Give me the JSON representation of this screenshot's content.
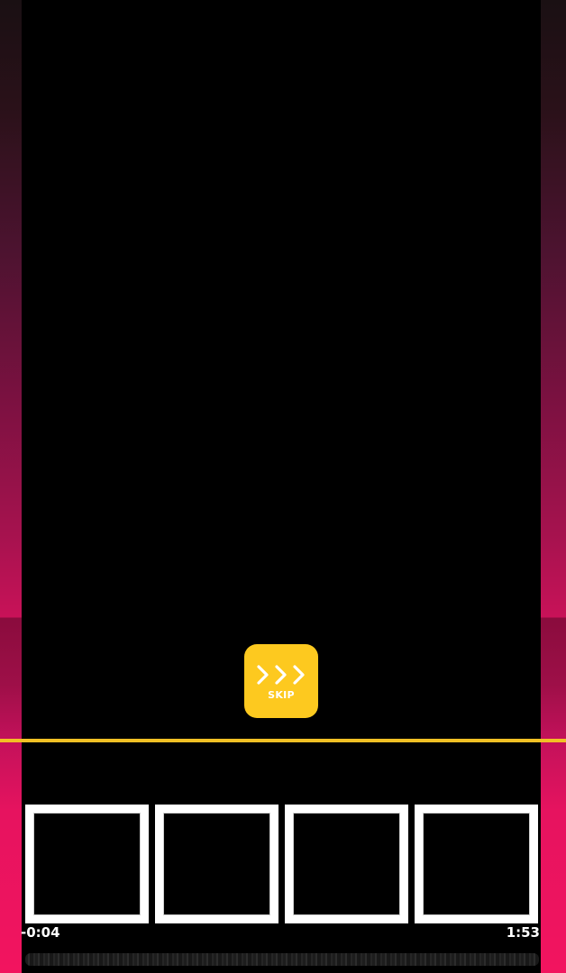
{
  "skip": {
    "label": "SKIP",
    "icon": "triple-chevron-right-icon",
    "color": "#fdc91f"
  },
  "timeline": {
    "elapsed": "-0:04",
    "total": "1:53",
    "accent_color": "#f2c025",
    "thumbnail_count": 4
  },
  "theme": {
    "side_gradient_top": "#1a1013",
    "side_gradient_bottom": "#f2145f",
    "background": "#000000"
  }
}
